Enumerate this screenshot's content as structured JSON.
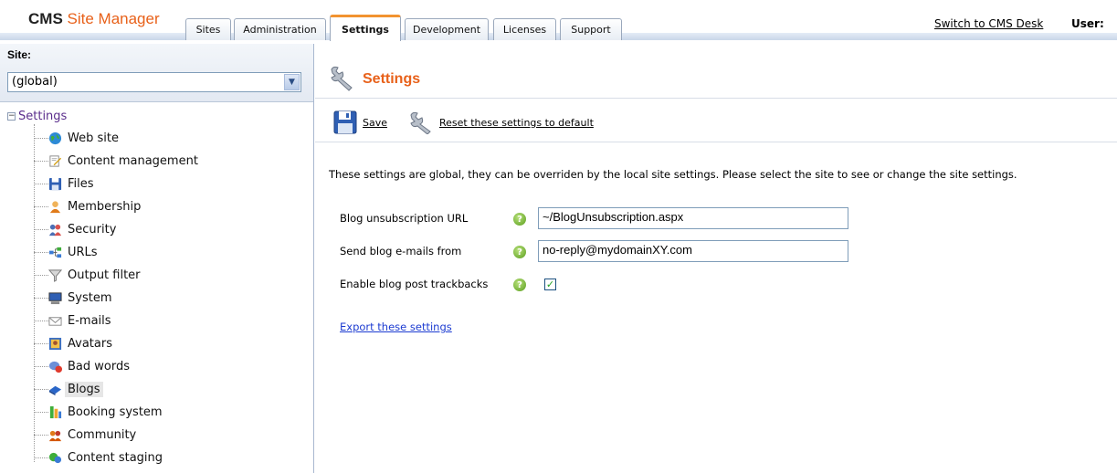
{
  "app": {
    "logo_brand": "CMS",
    "logo_text": "Site Manager"
  },
  "header": {
    "tabs": [
      {
        "label": "Sites"
      },
      {
        "label": "Administration"
      },
      {
        "label": "Settings",
        "active": true
      },
      {
        "label": "Development"
      },
      {
        "label": "Licenses"
      },
      {
        "label": "Support"
      }
    ],
    "switch_link": "Switch to CMS Desk",
    "user_label": "User:"
  },
  "sidebar": {
    "site_label": "Site:",
    "site_selected": "(global)",
    "tree_root": "Settings",
    "items": [
      {
        "label": "Web site",
        "icon": "globe-icon"
      },
      {
        "label": "Content management",
        "icon": "document-edit-icon"
      },
      {
        "label": "Files",
        "icon": "floppy-icon"
      },
      {
        "label": "Membership",
        "icon": "user-icon"
      },
      {
        "label": "Security",
        "icon": "security-users-icon"
      },
      {
        "label": "URLs",
        "icon": "url-icon"
      },
      {
        "label": "Output filter",
        "icon": "filter-icon"
      },
      {
        "label": "System",
        "icon": "monitor-icon"
      },
      {
        "label": "E-mails",
        "icon": "envelope-icon"
      },
      {
        "label": "Avatars",
        "icon": "avatar-icon"
      },
      {
        "label": "Bad words",
        "icon": "bad-words-icon"
      },
      {
        "label": "Blogs",
        "icon": "blog-icon",
        "selected": true
      },
      {
        "label": "Booking system",
        "icon": "booking-icon"
      },
      {
        "label": "Community",
        "icon": "community-icon"
      },
      {
        "label": "Content staging",
        "icon": "staging-icon"
      }
    ]
  },
  "main": {
    "title": "Settings",
    "save_label": "Save",
    "reset_label": "Reset these settings to default",
    "info_text": "These settings are global, they can be overriden by the local site settings. Please select the site to see or change the site settings.",
    "fields": {
      "unsubscription_label": "Blog unsubscription URL",
      "unsubscription_value": "~/BlogUnsubscription.aspx",
      "send_from_label": "Send blog e-mails from",
      "send_from_value": "no-reply@mydomainXY.com",
      "trackbacks_label": "Enable blog post trackbacks",
      "trackbacks_checked": true
    },
    "export_link": "Export these settings"
  },
  "colors": {
    "accent_orange": "#e8611a",
    "link_blue": "#1c3bd1",
    "help_green": "#5a9e1e"
  }
}
